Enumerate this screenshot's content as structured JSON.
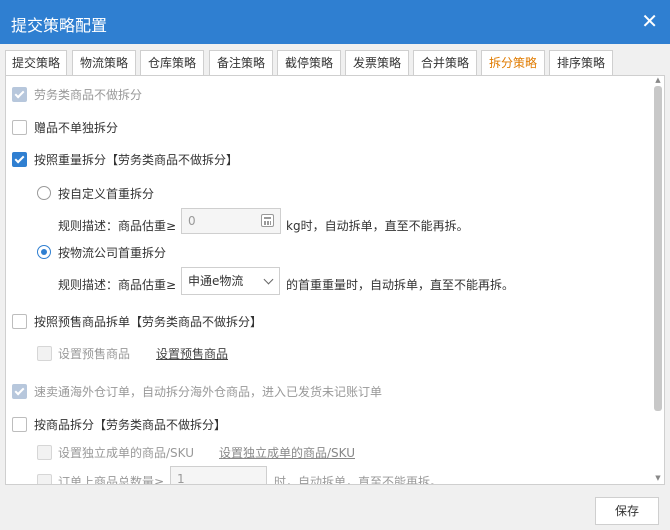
{
  "dialog": {
    "title": "提交策略配置",
    "close_icon": "close-icon"
  },
  "tabs": [
    {
      "label": "提交策略"
    },
    {
      "label": "物流策略"
    },
    {
      "label": "仓库策略"
    },
    {
      "label": "备注策略"
    },
    {
      "label": "截停策略"
    },
    {
      "label": "发票策略"
    },
    {
      "label": "合并策略"
    },
    {
      "label": "拆分策略",
      "active": true
    },
    {
      "label": "排序策略"
    }
  ],
  "options": {
    "service_no_split": {
      "label": "劳务类商品不做拆分",
      "checked": true,
      "disabled": true
    },
    "gift_not_split": {
      "label": "赠品不单独拆分",
      "checked": false
    },
    "weight_split": {
      "label": "按照重量拆分",
      "note": "【劳务类商品不做拆分】",
      "checked": true
    },
    "custom_weight": {
      "label": "按自定义首重拆分",
      "rule_prefix": "规则描述：商品估重≥",
      "value": "0",
      "rule_suffix": "kg时，自动拆单，直至不能再拆。"
    },
    "carrier_weight": {
      "label": "按物流公司首重拆分",
      "rule_prefix": "规则描述：商品估重≥",
      "selected": "申通e物流",
      "rule_suffix": "的首重重量时，自动拆单，直至不能再拆。"
    },
    "presale_split": {
      "label": "按照预售商品拆单",
      "note": "【劳务类商品不做拆分】",
      "checked": false
    },
    "presale_set": {
      "label": "设置预售商品",
      "link": "设置预售商品"
    },
    "overseas": {
      "label": "速卖通海外仓订单，自动拆分海外仓商品，进入已发货未记账订单",
      "checked": true,
      "disabled": true
    },
    "goods_split": {
      "label": "按商品拆分",
      "note": "【劳务类商品不做拆分】",
      "checked": false
    },
    "sku_independent": {
      "label": "设置独立成单的商品/SKU",
      "link": "设置独立成单的商品/SKU"
    },
    "qty_split": {
      "prefix": "订单上商品总数量≥",
      "value": "1",
      "suffix": "时，自动拆单，直至不能再拆。"
    }
  },
  "footer": {
    "save": "保存"
  }
}
